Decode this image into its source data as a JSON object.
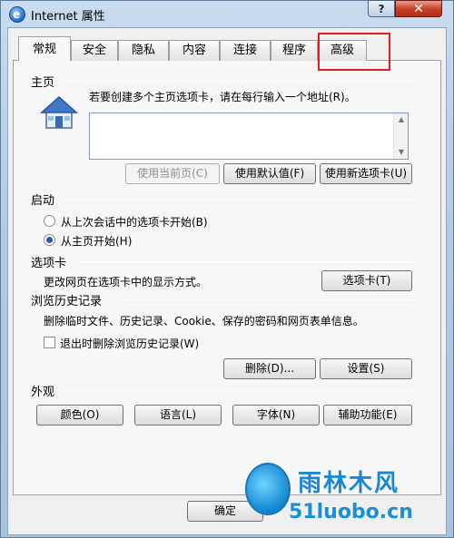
{
  "window": {
    "title": "Internet 属性",
    "help_label": "?",
    "close_label": "✕"
  },
  "tabs": [
    {
      "label": "常规",
      "selected": true
    },
    {
      "label": "安全"
    },
    {
      "label": "隐私"
    },
    {
      "label": "内容"
    },
    {
      "label": "连接"
    },
    {
      "label": "程序"
    },
    {
      "label": "高级"
    }
  ],
  "homepage": {
    "heading": "主页",
    "instruction": "若要创建多个主页选项卡，请在每行输入一个地址(R)。",
    "value": "",
    "buttons": {
      "use_current": "使用当前页(C)",
      "use_default": "使用默认值(F)",
      "use_new_tab": "使用新选项卡(U)"
    }
  },
  "startup": {
    "heading": "启动",
    "options": [
      {
        "label": "从上次会话中的选项卡开始(B)",
        "checked": false
      },
      {
        "label": "从主页开始(H)",
        "checked": true
      }
    ]
  },
  "tabs_section": {
    "heading": "选项卡",
    "description": "更改网页在选项卡中的显示方式。",
    "button": "选项卡(T)"
  },
  "history": {
    "heading": "浏览历史记录",
    "description": "删除临时文件、历史记录、Cookie、保存的密码和网页表单信息。",
    "checkbox_label": "退出时删除浏览历史记录(W)",
    "checkbox_checked": false,
    "delete_button": "删除(D)...",
    "settings_button": "设置(S)"
  },
  "appearance": {
    "heading": "外观",
    "buttons": [
      "颜色(O)",
      "语言(L)",
      "字体(N)",
      "辅助功能(E)"
    ]
  },
  "footer": {
    "ok_button": "确定"
  },
  "watermark": {
    "brand": "雨林木风",
    "url": "51luobo.cn"
  },
  "colors": {
    "title_bar": "#b8cfe4",
    "close_button": "#c8452d",
    "highlight_box": "#e02020",
    "watermark": "#1a86d6"
  }
}
